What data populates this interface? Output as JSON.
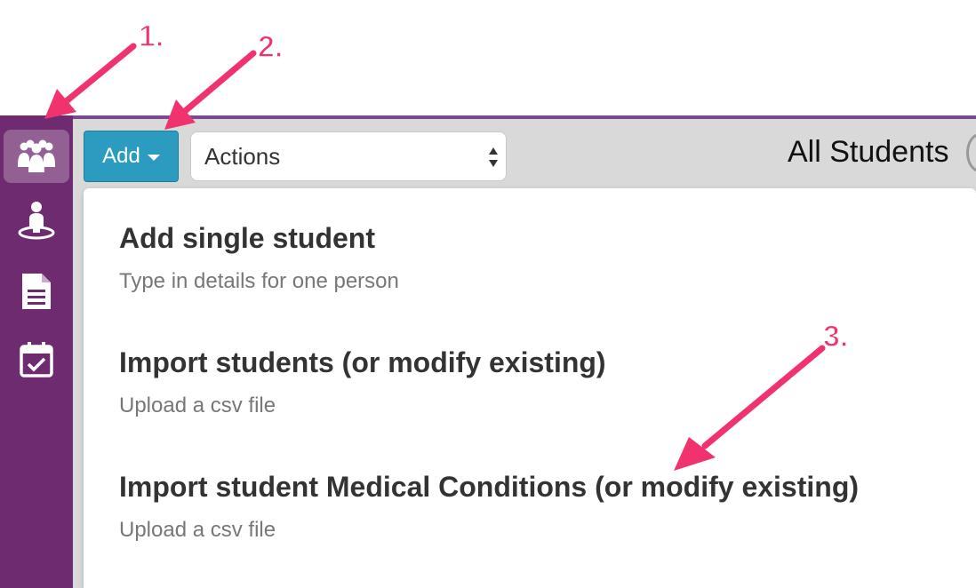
{
  "toolbar": {
    "add_label": "Add",
    "actions_select": "Actions"
  },
  "page": {
    "title": "All Students"
  },
  "sidebar": {
    "items": [
      "students-icon",
      "person-pin-icon",
      "document-icon",
      "calendar-check-icon"
    ]
  },
  "menu": {
    "items": [
      {
        "title": "Add single student",
        "subtitle": "Type in details for one person"
      },
      {
        "title": "Import students (or modify existing)",
        "subtitle": "Upload a csv file"
      },
      {
        "title": "Import student Medical Conditions (or modify existing)",
        "subtitle": "Upload a csv file"
      }
    ]
  },
  "annotations": {
    "step1": "1.",
    "step2": "2.",
    "step3": "3."
  },
  "colors": {
    "sidebar": "#6f2b6f",
    "accent": "#2b9bbf",
    "annotation": "#f0336e"
  }
}
